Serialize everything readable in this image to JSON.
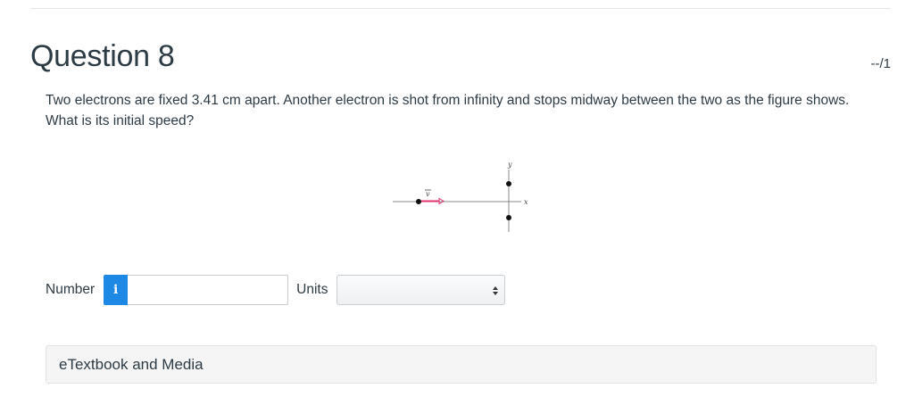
{
  "question": {
    "title": "Question 8",
    "score": "--/1",
    "text": "Two electrons are fixed 3.41 cm apart. Another electron is shot from infinity and stops midway between the two as the figure shows. What is its initial speed?"
  },
  "figure": {
    "y_axis_label": "y",
    "x_axis_label": "x",
    "velocity_label": "v",
    "arrow_color": "#e0336c"
  },
  "answer": {
    "number_label": "Number",
    "info_icon_glyph": "i",
    "number_value": "",
    "units_label": "Units",
    "units_selected": ""
  },
  "resources": {
    "etextbook_label": "eTextbook and Media"
  },
  "colors": {
    "info_button": "#1e88e5",
    "text": "#2d3b45"
  }
}
